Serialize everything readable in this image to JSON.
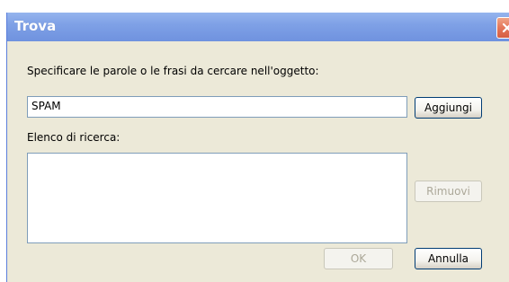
{
  "dialog": {
    "title": "Trova",
    "close_icon": "close-x-icon",
    "prompt_label": "Specificare le parole o le frasi da cercare nell'oggetto:",
    "search_value": "SPAM",
    "add_button": "Aggiungi",
    "list_label": "Elenco di ricerca:",
    "remove_button": "Rimuovi",
    "ok_button": "OK",
    "cancel_button": "Annulla"
  },
  "colors": {
    "titlebar": "#7fa1e6",
    "dialog_bg": "#ece9d8",
    "close_button": "#e4765a",
    "disabled_text": "#aca899"
  }
}
